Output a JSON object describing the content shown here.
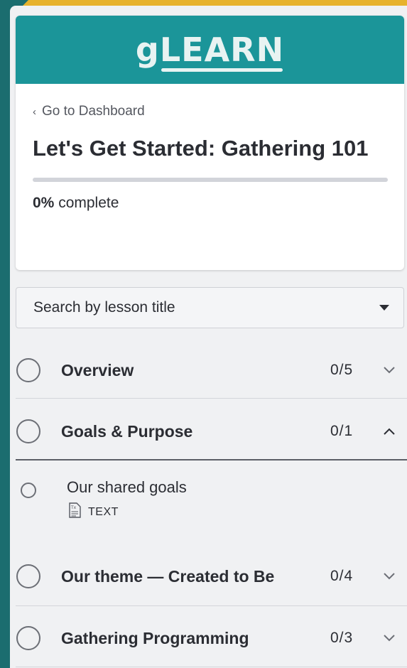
{
  "brand": {
    "logo_text": "gLEARN",
    "color": "#1b9599"
  },
  "nav": {
    "back_label": "Go to Dashboard"
  },
  "course": {
    "title": "Let's Get Started: Gathering 101",
    "progress_percent": 0,
    "progress_value": "0%",
    "progress_suffix": "complete"
  },
  "search": {
    "placeholder": "Search by lesson title"
  },
  "sections": [
    {
      "title": "Overview",
      "count": "0/5",
      "expanded": false
    },
    {
      "title": "Goals & Purpose",
      "count": "0/1",
      "expanded": true,
      "lessons": [
        {
          "title": "Our shared goals",
          "type": "TEXT",
          "icon": "text-document-icon"
        }
      ]
    },
    {
      "title": "Our theme — Created to Be",
      "count": "0/4",
      "expanded": false
    },
    {
      "title": "Gathering Programming",
      "count": "0/3",
      "expanded": false
    }
  ],
  "colors": {
    "background_teal": "#1b6d6f",
    "background_yellow": "#e7b22d",
    "panel": "#f0f1f3"
  }
}
